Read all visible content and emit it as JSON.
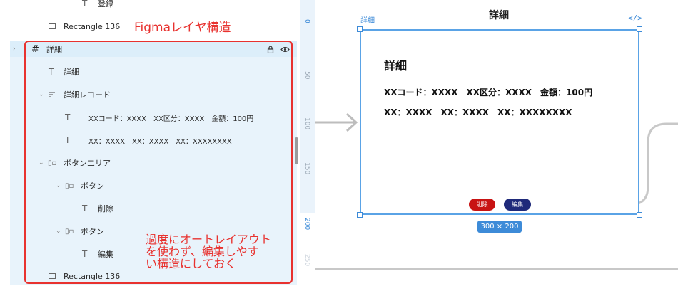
{
  "layers": {
    "top_item": "登録",
    "rectangle_top": "Rectangle 136",
    "frame": "詳細",
    "detail_text": "詳細",
    "record_group": "詳細レコード",
    "record_line1": "XXコード：XXXX　XX区分：XXXX　金額：100円",
    "record_line2": "XX：XXXX　XX：XXXX　XX：XXXXXXXX",
    "button_area": "ボタンエリア",
    "button1": "ボタン",
    "delete_text": "削除",
    "button2": "ボタン",
    "edit_text": "編集",
    "rectangle_bottom": "Rectangle 136"
  },
  "annotations": {
    "title": "Figmaレイヤ構造",
    "note_line1": "過度にオートレイアウト",
    "note_line2": "を使わず、編集しやす",
    "note_line3": "い構造にしておく"
  },
  "ruler": {
    "ticks": [
      "0",
      "50",
      "100",
      "150",
      "200",
      "250"
    ]
  },
  "canvas": {
    "frame_label": "詳細",
    "frame_title": "詳細",
    "code_icon": "</>",
    "detail_title": "詳細",
    "line1": "XXコード：XXXX　XX区分：XXXX　金額：100円",
    "line2": "XX：XXXX　XX：XXXX　XX：XXXXXXXX",
    "delete_button": "削除",
    "edit_button": "編集",
    "size_badge": "300 × 200"
  },
  "icons": {
    "frame": "hash-frame-icon",
    "text": "text-icon",
    "rectangle": "rectangle-icon",
    "autolayout": "autolayout-icon",
    "lock": "lock-icon",
    "eye": "eye-icon"
  },
  "colors": {
    "selection": "#e8f3fb",
    "annotation": "#e8322f",
    "frame_border": "#5aa3e6",
    "delete": "#c81313",
    "edit": "#1f2a7a",
    "accent": "#3d8bd8"
  }
}
